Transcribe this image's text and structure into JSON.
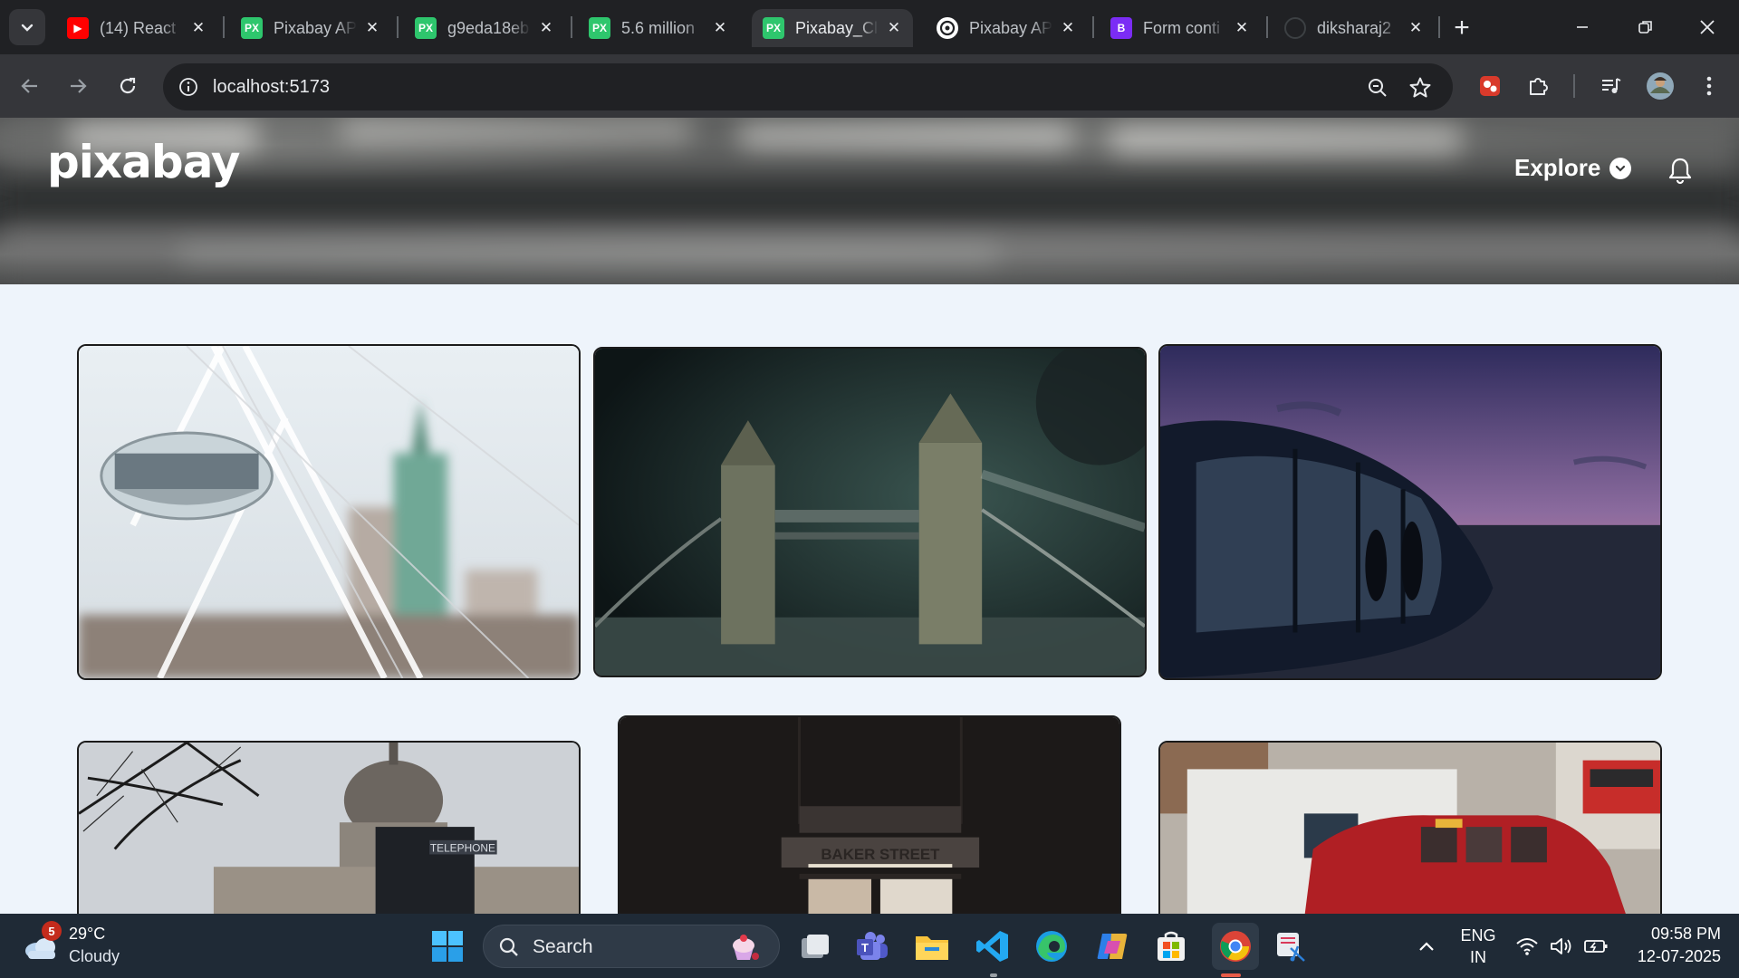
{
  "browser": {
    "tabs": [
      {
        "label": "(14) React",
        "favicon": "youtube-icon",
        "color": "#ff0000",
        "glyph": "▶",
        "active": false
      },
      {
        "label": "Pixabay AP",
        "favicon": "pixabay-icon",
        "color": "#2ec66d",
        "glyph": "PX",
        "active": false
      },
      {
        "label": "g9eda18eb",
        "favicon": "pixabay-icon",
        "color": "#2ec66d",
        "glyph": "PX",
        "active": false
      },
      {
        "label": "5.6 million",
        "favicon": "pixabay-icon",
        "color": "#2ec66d",
        "glyph": "PX",
        "active": false
      },
      {
        "label": "Pixabay_Cl",
        "favicon": "pixabay-icon",
        "color": "#2ec66d",
        "glyph": "PX",
        "active": true
      },
      {
        "label": "Pixabay AP",
        "favicon": "openai-icon",
        "color": "#ffffff",
        "glyph": "",
        "active": false
      },
      {
        "label": "Form conti",
        "favicon": "bootstrap-icon",
        "color": "#7b2cf5",
        "glyph": "B",
        "active": false
      },
      {
        "label": "diksharaj2",
        "favicon": "github-icon",
        "color": "#202124",
        "glyph": "",
        "active": false
      }
    ],
    "address_url": "localhost:5173"
  },
  "page": {
    "logo_text": "pixabay",
    "explore_label": "Explore"
  },
  "gallery": {
    "images": [
      {
        "subject": "London Eye capsule"
      },
      {
        "subject": "Tower Bridge at night"
      },
      {
        "subject": "London Eye capsule at sunset"
      },
      {
        "subject": "St Paul's Cathedral and telephone box"
      },
      {
        "subject": "Baker Street station"
      },
      {
        "subject": "Red London taxi"
      }
    ],
    "baker_street_sign": "BAKER STREET",
    "telephone_sign": "TELEPHONE"
  },
  "taskbar": {
    "weather_temp": "29°C",
    "weather_desc": "Cloudy",
    "weather_badge": "5",
    "search_placeholder": "Search",
    "language_line1": "ENG",
    "language_line2": "IN",
    "time": "09:58 PM",
    "date": "12-07-2025"
  },
  "colors": {
    "page_background": "#eef4fb",
    "taskbar": "#1f2a36",
    "browser_chrome": "#35363a"
  }
}
